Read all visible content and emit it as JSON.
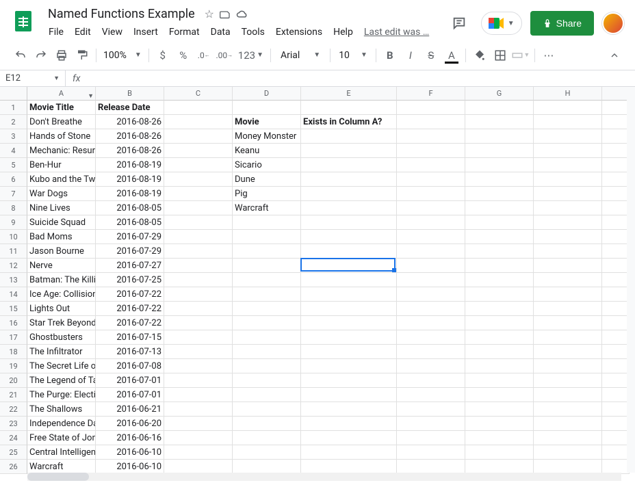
{
  "doc_title": "Named Functions Example",
  "menus": [
    "File",
    "Edit",
    "View",
    "Insert",
    "Format",
    "Data",
    "Tools",
    "Extensions",
    "Help"
  ],
  "last_edit": "Last edit was …",
  "share_label": "Share",
  "zoom": "100%",
  "format_number": "123",
  "font_name": "Arial",
  "font_size": "10",
  "name_box": "E12",
  "columns": [
    "A",
    "B",
    "C",
    "D",
    "E",
    "F",
    "G",
    "H"
  ],
  "selection": {
    "col": "E",
    "row": 12
  },
  "chart_data": {
    "type": "table",
    "headers_row1": {
      "A": "Movie Title",
      "B": "Release Date"
    },
    "headers_row2": {
      "D": "Movie",
      "E": "Exists in Column A?"
    },
    "rows": [
      {
        "n": 1,
        "A": "Movie Title",
        "B": "Release Date",
        "bold": true
      },
      {
        "n": 2,
        "A": "Don't Breathe",
        "B": "2016-08-26",
        "D": "Movie",
        "E": "Exists in Column A?",
        "dbold": true
      },
      {
        "n": 3,
        "A": "Hands of Stone",
        "B": "2016-08-26",
        "D": "Money Monster"
      },
      {
        "n": 4,
        "A": "Mechanic: Resurrection",
        "B": "2016-08-26",
        "D": "Keanu"
      },
      {
        "n": 5,
        "A": "Ben-Hur",
        "B": "2016-08-19",
        "D": "Sicario"
      },
      {
        "n": 6,
        "A": "Kubo and the Two Strings",
        "B": "2016-08-19",
        "D": "Dune"
      },
      {
        "n": 7,
        "A": "War Dogs",
        "B": "2016-08-19",
        "D": "Pig"
      },
      {
        "n": 8,
        "A": "Nine Lives",
        "B": "2016-08-05",
        "D": "Warcraft"
      },
      {
        "n": 9,
        "A": "Suicide Squad",
        "B": "2016-08-05"
      },
      {
        "n": 10,
        "A": "Bad Moms",
        "B": "2016-07-29"
      },
      {
        "n": 11,
        "A": "Jason Bourne",
        "B": "2016-07-29"
      },
      {
        "n": 12,
        "A": "Nerve",
        "B": "2016-07-27"
      },
      {
        "n": 13,
        "A": "Batman: The Killing Joke",
        "B": "2016-07-25"
      },
      {
        "n": 14,
        "A": "Ice Age: Collision Course",
        "B": "2016-07-22"
      },
      {
        "n": 15,
        "A": "Lights Out",
        "B": "2016-07-22"
      },
      {
        "n": 16,
        "A": "Star Trek Beyond",
        "B": "2016-07-22"
      },
      {
        "n": 17,
        "A": "Ghostbusters",
        "B": "2016-07-15"
      },
      {
        "n": 18,
        "A": "The Infiltrator",
        "B": "2016-07-13"
      },
      {
        "n": 19,
        "A": "The Secret Life of Pets",
        "B": "2016-07-08"
      },
      {
        "n": 20,
        "A": "The Legend of Tarzan",
        "B": "2016-07-01"
      },
      {
        "n": 21,
        "A": "The Purge: Election Year",
        "B": "2016-07-01"
      },
      {
        "n": 22,
        "A": "The Shallows",
        "B": "2016-06-21"
      },
      {
        "n": 23,
        "A": "Independence Day: Resurgence",
        "B": "2016-06-20"
      },
      {
        "n": 24,
        "A": "Free State of Jones",
        "B": "2016-06-16"
      },
      {
        "n": 25,
        "A": "Central Intelligence",
        "B": "2016-06-10"
      },
      {
        "n": 26,
        "A": "Warcraft",
        "B": "2016-06-10"
      }
    ]
  }
}
